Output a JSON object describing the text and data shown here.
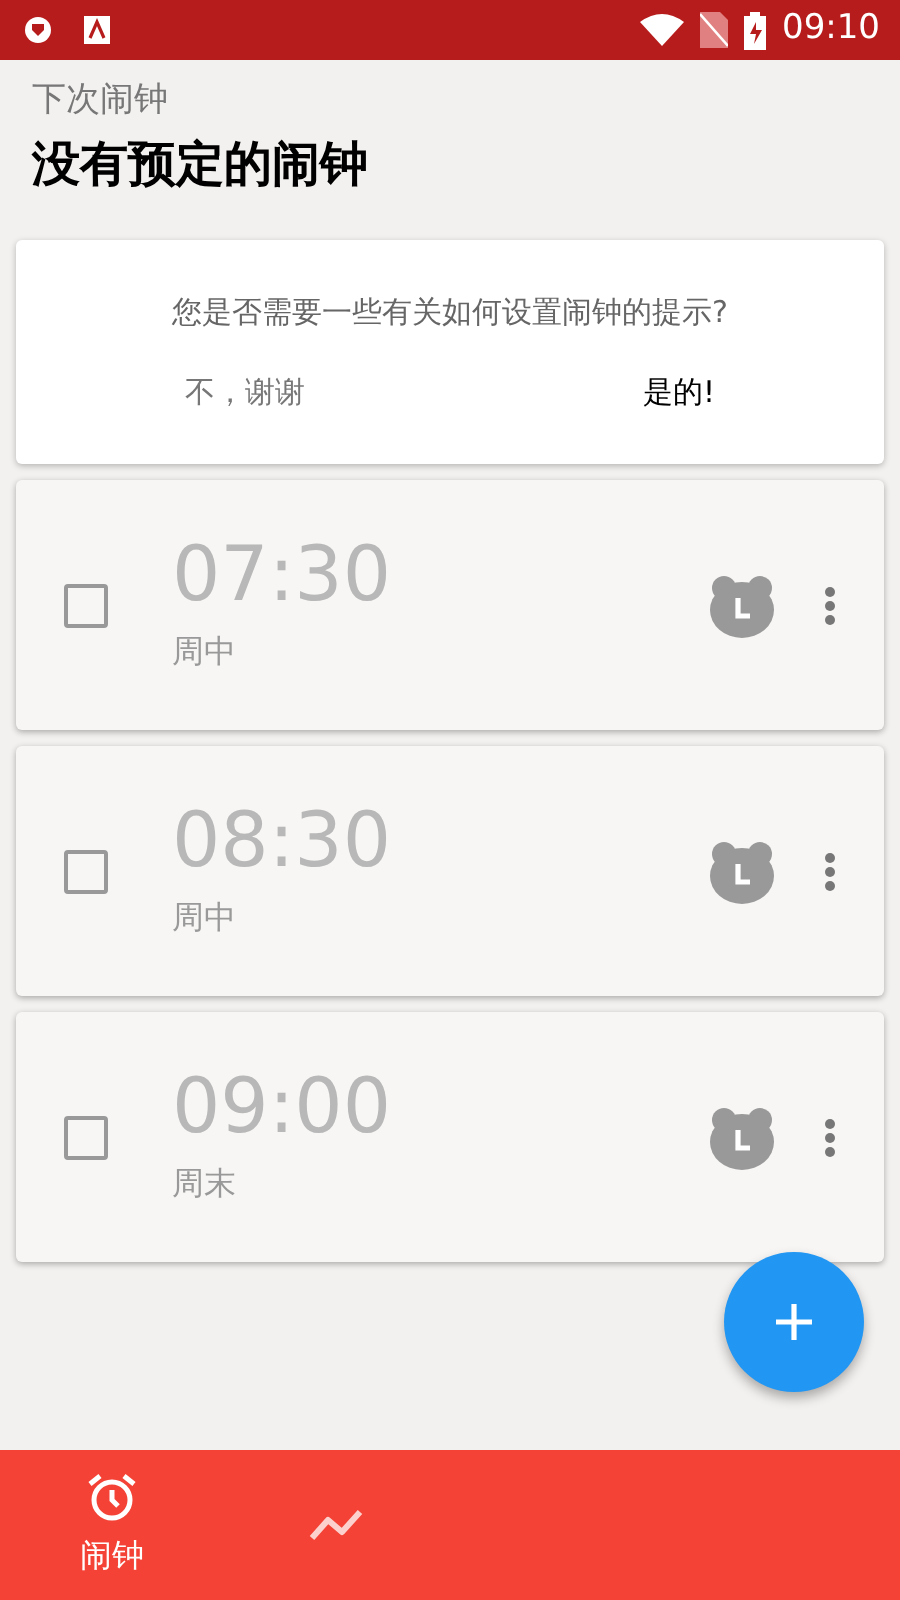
{
  "status_bar": {
    "time": "09:10"
  },
  "header": {
    "subtitle": "下次闹钟",
    "title": "没有预定的闹钟"
  },
  "tip_card": {
    "question": "您是否需要一些有关如何设置闹钟的提示?",
    "buttons": [
      {
        "label": "不，谢谢",
        "kind": "dismiss"
      },
      {
        "label": "是的!",
        "kind": "accept"
      }
    ]
  },
  "alarms": [
    {
      "time": "07:30",
      "days": "周中",
      "checked": false
    },
    {
      "time": "08:30",
      "days": "周中",
      "checked": false
    },
    {
      "time": "09:00",
      "days": "周末",
      "checked": false
    }
  ],
  "bottom_nav": [
    {
      "kind": "alarm",
      "label": "闹钟",
      "selected": true
    },
    {
      "kind": "stats",
      "selected": false
    }
  ]
}
